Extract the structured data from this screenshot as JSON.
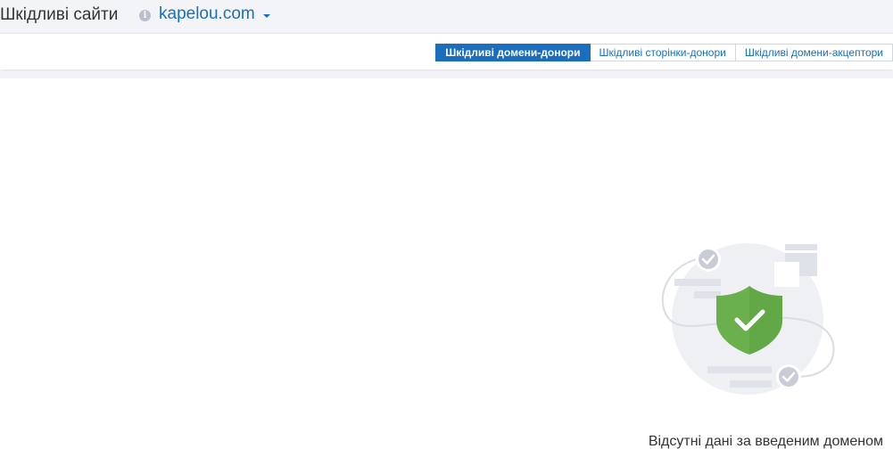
{
  "header": {
    "title": "Шкідливі сайти",
    "domain": "kapelou.com"
  },
  "tabs": [
    {
      "label": "Шкідливі домени-донори",
      "active": true
    },
    {
      "label": "Шкідливі сторінки-донори",
      "active": false
    },
    {
      "label": "Шкідливі домени-акцептори",
      "active": false
    }
  ],
  "empty_state": {
    "message": "Відсутні дані за введеним доменом"
  },
  "colors": {
    "accent": "#1b6dbd",
    "link": "#1a6fba",
    "shield": "#6ab04c",
    "header_bg": "#f3f4f7"
  },
  "icons": [
    "info-icon",
    "chevron-down-icon",
    "shield-check-icon",
    "check-circle-icon"
  ]
}
